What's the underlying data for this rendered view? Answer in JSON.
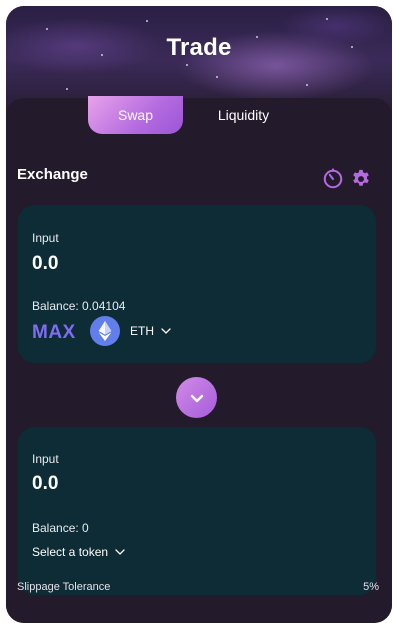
{
  "header": {
    "title": "Trade"
  },
  "tabs": [
    {
      "label": "Swap",
      "active": true
    },
    {
      "label": "Liquidity",
      "active": false
    }
  ],
  "exchange": {
    "label": "Exchange",
    "icons": [
      "history-timer-icon",
      "settings-gear-icon"
    ]
  },
  "from": {
    "label": "Input",
    "amount": "0.0",
    "balance": "Balance: 0.04104",
    "max_label": "MAX",
    "token": {
      "symbol": "ETH",
      "icon": "ethereum-icon"
    }
  },
  "swap_direction": {
    "icon": "chevron-down-icon"
  },
  "to": {
    "label": "Input",
    "amount": "0.0",
    "balance": "Balance: 0",
    "select_label": "Select a token"
  },
  "slippage": {
    "label": "Slippage Tolerance",
    "value": "5%"
  },
  "colors": {
    "background": "#231a2c",
    "input_box": "#0d2c35",
    "accent": "#b46be0",
    "max": "#7e6cf3",
    "eth": "#627eea"
  }
}
